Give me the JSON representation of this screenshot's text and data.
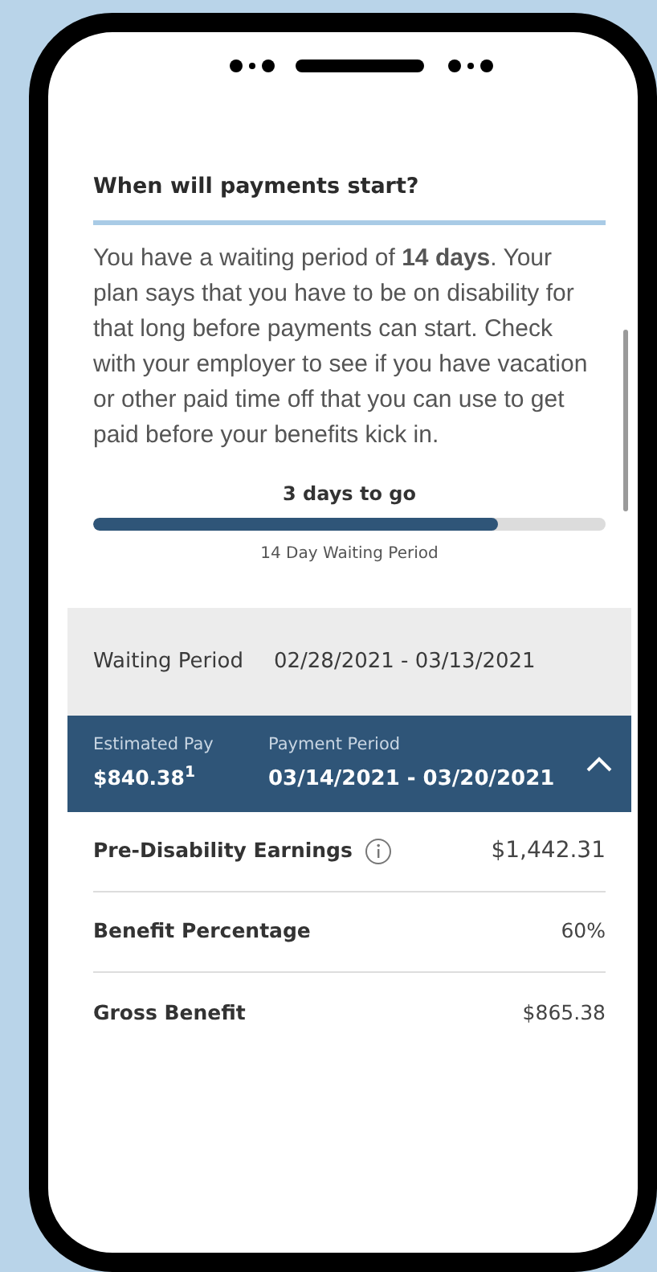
{
  "section": {
    "title": "When will payments start?",
    "body": "You have a waiting period of **14 days**. Your plan says that you have to be on disability for that long before payments can start. Check with your employer to see if you have vacation or other paid time off that you can use to get paid before your benefits kick in."
  },
  "progress": {
    "caption": "3 days to go",
    "level": 0.79,
    "label": "14 Day Waiting Period"
  },
  "waiting_period": {
    "label": "Waiting Period",
    "dates": "02/28/2021 - 03/13/2021"
  },
  "payment": {
    "estimated_label": "Estimated Pay",
    "estimated_value": "$840.38$^{1}$",
    "period_label": "Payment Period",
    "period_value": "03/14/2021 - 03/20/2021",
    "expanded": true
  },
  "details": [
    {
      "label": "Pre-Disability Earnings",
      "info": true,
      "value": "$1,442.31"
    },
    {
      "label": "Benefit Percentage",
      "info": false,
      "value": "60%"
    },
    {
      "label": "Gross Benefit",
      "info": false,
      "value": "$865.38"
    }
  ]
}
